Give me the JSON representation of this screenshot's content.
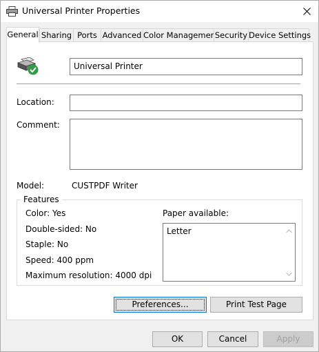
{
  "window": {
    "title": "Universal Printer Properties",
    "icons": {
      "title": "printer-icon",
      "close": "close-icon"
    }
  },
  "tabs": [
    {
      "label": "General",
      "active": true
    },
    {
      "label": "Sharing"
    },
    {
      "label": "Ports"
    },
    {
      "label": "Advanced"
    },
    {
      "label": "Color Management"
    },
    {
      "label": "Security"
    },
    {
      "label": "Device Settings"
    }
  ],
  "general": {
    "printer_name": "Universal Printer",
    "printer_icon": "printer-ready-icon",
    "location_label": "Location:",
    "location_value": "",
    "comment_label": "Comment:",
    "comment_value": "",
    "model_label": "Model:",
    "model_value": "CUSTPDF Writer"
  },
  "features": {
    "title": "Features",
    "color": "Color: Yes",
    "double_sided": "Double-sided: No",
    "staple": "Staple: No",
    "speed": "Speed: 400 ppm",
    "max_resolution": "Maximum resolution: 4000 dpi",
    "paper_label": "Paper available:",
    "paper_items": [
      "Letter"
    ]
  },
  "buttons": {
    "preferences": "Preferences...",
    "print_test": "Print Test Page",
    "ok": "OK",
    "cancel": "Cancel",
    "apply": "Apply"
  },
  "colors": {
    "accent": "#0078d7",
    "check": "#2e9e44"
  }
}
